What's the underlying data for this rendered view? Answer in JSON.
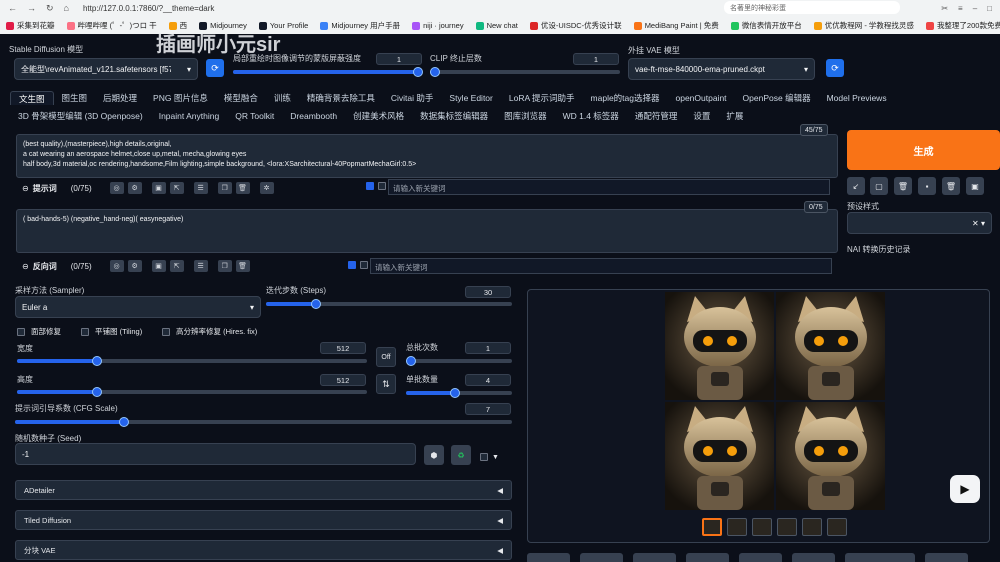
{
  "browser": {
    "url": "http://127.0.0.1:7860/?__theme=dark",
    "search_placeholder": "名著里的神秘彩蛋",
    "bookmarks": [
      "采集到花瓣",
      "哔哩哔哩 (゜-゜)つロ 干",
      "西",
      "Midjourney",
      "Your Profile",
      "Midjourney 用户手册",
      "niji · journey",
      "New chat",
      "优设-UISDC-优秀设计联",
      "MediBang Paint | 免费",
      "微信表情开放平台",
      "优优教程网 - 学教程找灵感",
      "我整理了200款免费商用字"
    ]
  },
  "header": {
    "model_label": "Stable Diffusion 模型",
    "model_value": "全能型\\revAnimated_v121.safetensors [f57b21e]",
    "mask_label": "局部重绘时图像调节的蒙版屏蔽强度",
    "mask_value": "1",
    "clip_label": "CLIP 终止层数",
    "clip_value": "1",
    "vae_label": "外挂 VAE 模型",
    "vae_value": "vae-ft-mse-840000-ema-pruned.ckpt",
    "watermark": "插画师小元sir"
  },
  "tabs_row1": [
    "文生图",
    "图生图",
    "后期处理",
    "PNG 图片信息",
    "模型融合",
    "训练",
    "精确背景去除工具",
    "Civitai 助手",
    "Style Editor",
    "LoRA 提示词助手",
    "maple的tag选择器",
    "openOutpaint",
    "OpenPose 编辑器",
    "Model Previews"
  ],
  "tabs_row2": [
    "3D 骨架模型编辑 (3D Openpose)",
    "Inpaint Anything",
    "QR Toolkit",
    "Dreambooth",
    "创建美术风格",
    "数据集标签编辑器",
    "图库浏览器",
    "WD 1.4 标签器",
    "通配符管理",
    "设置",
    "扩展"
  ],
  "prompt": {
    "text": "(best quality),(masterpiece),high details,original,\na cat wearing an aerospace helmet,close up,metal, mecha,glowing eyes\nhalf body,3d material,oc rendering,handsome,Film lighting,simple background, <lora:XSarchitectural-40PopmartMechaGirl:0.5>",
    "counter": "45/75",
    "label": "提示词",
    "count": "(0/75)",
    "keyword_placeholder": "请输入新关键词"
  },
  "negative": {
    "text": "( bad-hands-5) (negative_hand-neg)( easynegative)",
    "counter": "0/75",
    "label": "反向词",
    "count": "(0/75)",
    "keyword_placeholder": "请输入新关键词"
  },
  "right_panel": {
    "generate": "生成",
    "preset_label": "预设样式",
    "nai_label": "NAI 转换历史记录"
  },
  "params": {
    "sampler_label": "采样方法 (Sampler)",
    "sampler_value": "Euler a",
    "steps_label": "迭代步数 (Steps)",
    "steps_value": "30",
    "steps_fraction": 0.2,
    "face_restore": "面部修复",
    "tiling": "平铺图 (Tiling)",
    "hires": "高分辨率修复 (Hires. fix)",
    "width_label": "宽度",
    "width_value": "512",
    "height_label": "高度",
    "height_value": "512",
    "off_label": "Off",
    "batch_count_label": "总批次数",
    "batch_count_value": "1",
    "batch_size_label": "单批数量",
    "batch_size_value": "4",
    "cfg_label": "提示词引导系数 (CFG Scale)",
    "cfg_value": "7",
    "seed_label": "随机数种子 (Seed)",
    "seed_value": "-1"
  },
  "accordions": [
    "ADetailer",
    "Tiled Diffusion",
    "分块 VAE"
  ],
  "colors": {
    "accent": "#2563eb",
    "generate": "#f97316",
    "bg": "#0b0f19"
  }
}
